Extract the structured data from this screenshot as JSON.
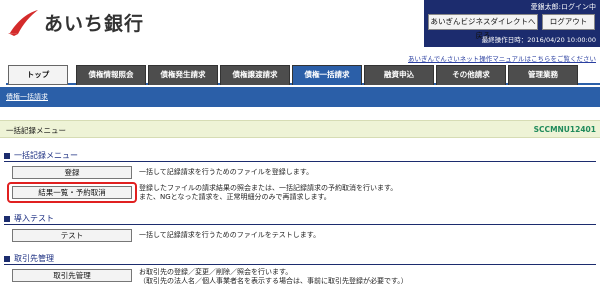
{
  "brand": {
    "name": "あいち銀行"
  },
  "user": {
    "display_name": "愛銀太郎:ログイン中",
    "portal_button": "あいぎんビジネスダイレクトへ戻る",
    "logout_button": "ログアウト",
    "last_operation": "最終操作日時：2016/04/20 10:00:00"
  },
  "help_link": "あいぎんでんさいネット操作マニュアルはこちらをご覧ください",
  "tabs": [
    {
      "label": "トップ"
    },
    {
      "label": "債権情報照会"
    },
    {
      "label": "債権発生請求"
    },
    {
      "label": "債権譲渡請求"
    },
    {
      "label": "債権一括請求"
    },
    {
      "label": "融資申込"
    },
    {
      "label": "その他請求"
    },
    {
      "label": "管理業務"
    }
  ],
  "subnav": {
    "link": "債権一括請求"
  },
  "screen": {
    "title": "一括記録メニュー",
    "code": "SCCMNU12401"
  },
  "sections": [
    {
      "heading": "一括記録メニュー",
      "items": [
        {
          "button": "登録",
          "desc": [
            "一括して記録請求を行うためのファイルを登録します。"
          ]
        },
        {
          "button": "結果一覧・予約取消",
          "desc": [
            "登録したファイルの請求結果の照会または、一括記録請求の予約取消を行います。",
            "また、NGとなった請求を、正常明細分のみで再請求します。"
          ]
        }
      ]
    },
    {
      "heading": "導入テスト",
      "items": [
        {
          "button": "テスト",
          "desc": [
            "一括して記録請求を行うためのファイルをテストします。"
          ]
        }
      ]
    },
    {
      "heading": "取引先管理",
      "items": [
        {
          "button": "取引先管理",
          "desc": [
            "お取引先の登録／変更／削除／照会を行います。",
            "（取引先の法人名／個人事業者名を表示する場合は、事前に取引先登録が必要です。）"
          ]
        }
      ]
    }
  ],
  "colors": {
    "brand_navy": "#1c2c6e",
    "tab_active": "#2b5fa8",
    "tab_inactive": "#4d4d4d",
    "highlight": "#e02020",
    "code_green": "#1f8a5b"
  }
}
